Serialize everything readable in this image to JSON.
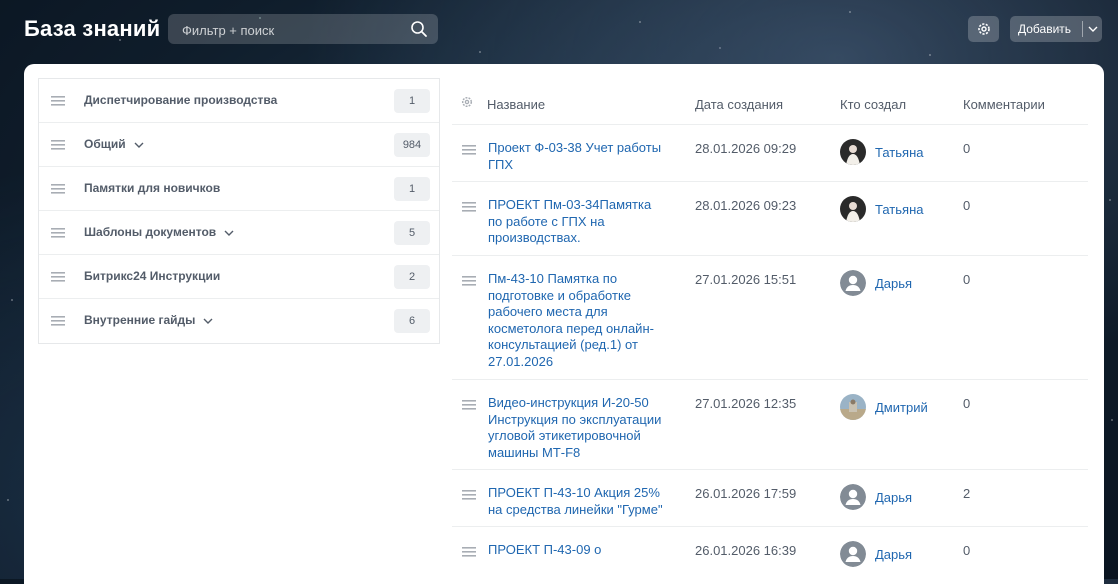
{
  "header": {
    "title": "База знаний",
    "search_placeholder": "Фильтр + поиск",
    "add_label": "Добавить"
  },
  "groups": [
    {
      "name": "Диспетчирование производства",
      "count": "1",
      "expandable": false
    },
    {
      "name": "Общий",
      "count": "984",
      "expandable": true
    },
    {
      "name": "Памятки для новичков",
      "count": "1",
      "expandable": false
    },
    {
      "name": "Шаблоны документов",
      "count": "5",
      "expandable": true
    },
    {
      "name": "Битрикс24 Инструкции",
      "count": "2",
      "expandable": false
    },
    {
      "name": "Внутренние гайды",
      "count": "6",
      "expandable": true
    }
  ],
  "table": {
    "columns": {
      "name": "Название",
      "created": "Дата создания",
      "author": "Кто создал",
      "comments": "Комментарии"
    },
    "rows": [
      {
        "title": "Проект Ф-03-38 Учет работы ГПХ",
        "date": "28.01.2026 09:29",
        "author": "Татьяна",
        "avatar": "photo-dark",
        "comments": "0"
      },
      {
        "title": "ПРОЕКТ Пм-03-34Памятка по работе с ГПХ на производствах.",
        "date": "28.01.2026 09:23",
        "author": "Татьяна",
        "avatar": "photo-dark",
        "comments": "0"
      },
      {
        "title": "Пм-43-10 Памятка по подготовке и обработке рабочего места для косметолога перед онлайн-консультацией (ред.1) от 27.01.2026",
        "date": "27.01.2026 15:51",
        "author": "Дарья",
        "avatar": "default-user",
        "comments": "0"
      },
      {
        "title": "Видео-инструкция И-20-50 Инструкция по эксплуатации угловой этикетировочной машины МТ-F8",
        "date": "27.01.2026 12:35",
        "author": "Дмитрий",
        "avatar": "photo-outdoor",
        "comments": "0"
      },
      {
        "title": "ПРОЕКТ П-43-10 Акция 25% на средства линейки \"Гурме\"",
        "date": "26.01.2026 17:59",
        "author": "Дарья",
        "avatar": "default-user",
        "comments": "2"
      },
      {
        "title": "ПРОЕКТ П-43-09 о",
        "date": "26.01.2026 16:39",
        "author": "Дарья",
        "avatar": "default-user",
        "comments": "0"
      }
    ]
  },
  "colors": {
    "link": "#2067b0",
    "muted_text": "#535c69",
    "badge_bg": "#eef0f2"
  }
}
